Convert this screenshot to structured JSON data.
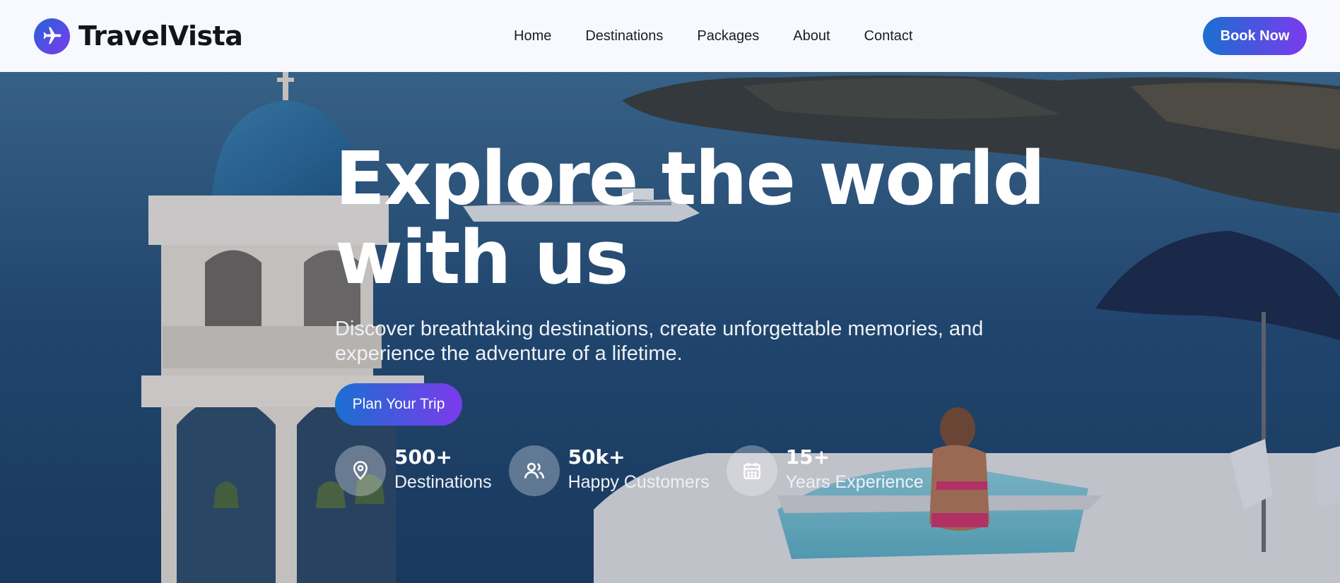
{
  "brand": {
    "name": "TravelVista",
    "logo_icon": "airplane-icon",
    "gradient": [
      "#2563d8",
      "#7c3aed"
    ]
  },
  "nav": {
    "links": [
      {
        "label": "Home"
      },
      {
        "label": "Destinations"
      },
      {
        "label": "Packages"
      },
      {
        "label": "About"
      },
      {
        "label": "Contact"
      }
    ],
    "cta_label": "Book Now"
  },
  "hero": {
    "title_line1": "Explore the world",
    "title_line2": "with us",
    "subtitle": "Discover breathtaking destinations, create unforgettable memories, and experience the adventure of a lifetime.",
    "cta_label": "Plan Your Trip",
    "background": "santorini-sea-photo"
  },
  "stats": [
    {
      "icon": "location-pin-icon",
      "value": "500+",
      "label": "Destinations"
    },
    {
      "icon": "users-icon",
      "value": "50k+",
      "label": "Happy Customers"
    },
    {
      "icon": "calendar-icon",
      "value": "15+",
      "label": "Years Experience"
    }
  ]
}
